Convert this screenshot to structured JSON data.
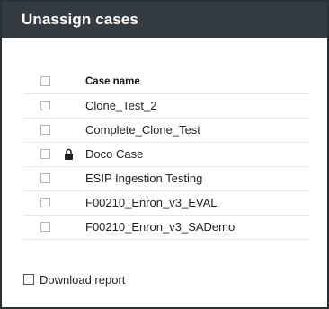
{
  "dialog": {
    "title": "Unassign cases"
  },
  "table": {
    "column_header": "Case name",
    "rows": [
      {
        "name": "Clone_Test_2",
        "locked": false
      },
      {
        "name": "Complete_Clone_Test",
        "locked": false
      },
      {
        "name": "Doco Case",
        "locked": true,
        "icon": "lock-icon"
      },
      {
        "name": "ESIP Ingestion Testing",
        "locked": false
      },
      {
        "name": "F00210_Enron_v3_EVAL",
        "locked": false
      },
      {
        "name": "F00210_Enron_v3_SADemo",
        "locked": false
      }
    ]
  },
  "download": {
    "label": "Download report",
    "checked": false
  },
  "colors": {
    "header_bg": "#343b41",
    "header_text": "#ffffff",
    "row_divider": "#e8e8e8"
  }
}
